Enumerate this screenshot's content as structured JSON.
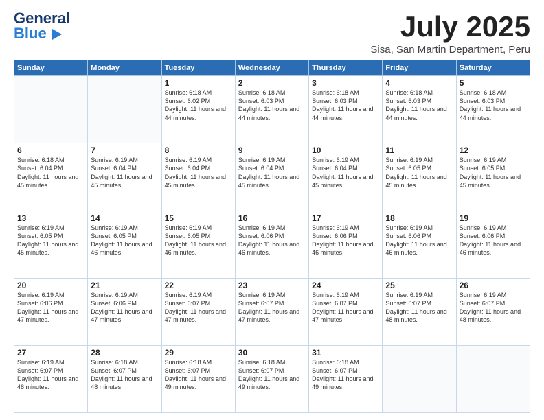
{
  "header": {
    "logo_general": "General",
    "logo_blue": "Blue",
    "month_title": "July 2025",
    "location": "Sisa, San Martin Department, Peru"
  },
  "weekdays": [
    "Sunday",
    "Monday",
    "Tuesday",
    "Wednesday",
    "Thursday",
    "Friday",
    "Saturday"
  ],
  "weeks": [
    [
      {
        "day": "",
        "info": ""
      },
      {
        "day": "",
        "info": ""
      },
      {
        "day": "1",
        "info": "Sunrise: 6:18 AM\nSunset: 6:02 PM\nDaylight: 11 hours and 44 minutes."
      },
      {
        "day": "2",
        "info": "Sunrise: 6:18 AM\nSunset: 6:03 PM\nDaylight: 11 hours and 44 minutes."
      },
      {
        "day": "3",
        "info": "Sunrise: 6:18 AM\nSunset: 6:03 PM\nDaylight: 11 hours and 44 minutes."
      },
      {
        "day": "4",
        "info": "Sunrise: 6:18 AM\nSunset: 6:03 PM\nDaylight: 11 hours and 44 minutes."
      },
      {
        "day": "5",
        "info": "Sunrise: 6:18 AM\nSunset: 6:03 PM\nDaylight: 11 hours and 44 minutes."
      }
    ],
    [
      {
        "day": "6",
        "info": "Sunrise: 6:18 AM\nSunset: 6:04 PM\nDaylight: 11 hours and 45 minutes."
      },
      {
        "day": "7",
        "info": "Sunrise: 6:19 AM\nSunset: 6:04 PM\nDaylight: 11 hours and 45 minutes."
      },
      {
        "day": "8",
        "info": "Sunrise: 6:19 AM\nSunset: 6:04 PM\nDaylight: 11 hours and 45 minutes."
      },
      {
        "day": "9",
        "info": "Sunrise: 6:19 AM\nSunset: 6:04 PM\nDaylight: 11 hours and 45 minutes."
      },
      {
        "day": "10",
        "info": "Sunrise: 6:19 AM\nSunset: 6:04 PM\nDaylight: 11 hours and 45 minutes."
      },
      {
        "day": "11",
        "info": "Sunrise: 6:19 AM\nSunset: 6:05 PM\nDaylight: 11 hours and 45 minutes."
      },
      {
        "day": "12",
        "info": "Sunrise: 6:19 AM\nSunset: 6:05 PM\nDaylight: 11 hours and 45 minutes."
      }
    ],
    [
      {
        "day": "13",
        "info": "Sunrise: 6:19 AM\nSunset: 6:05 PM\nDaylight: 11 hours and 45 minutes."
      },
      {
        "day": "14",
        "info": "Sunrise: 6:19 AM\nSunset: 6:05 PM\nDaylight: 11 hours and 46 minutes."
      },
      {
        "day": "15",
        "info": "Sunrise: 6:19 AM\nSunset: 6:05 PM\nDaylight: 11 hours and 46 minutes."
      },
      {
        "day": "16",
        "info": "Sunrise: 6:19 AM\nSunset: 6:06 PM\nDaylight: 11 hours and 46 minutes."
      },
      {
        "day": "17",
        "info": "Sunrise: 6:19 AM\nSunset: 6:06 PM\nDaylight: 11 hours and 46 minutes."
      },
      {
        "day": "18",
        "info": "Sunrise: 6:19 AM\nSunset: 6:06 PM\nDaylight: 11 hours and 46 minutes."
      },
      {
        "day": "19",
        "info": "Sunrise: 6:19 AM\nSunset: 6:06 PM\nDaylight: 11 hours and 46 minutes."
      }
    ],
    [
      {
        "day": "20",
        "info": "Sunrise: 6:19 AM\nSunset: 6:06 PM\nDaylight: 11 hours and 47 minutes."
      },
      {
        "day": "21",
        "info": "Sunrise: 6:19 AM\nSunset: 6:06 PM\nDaylight: 11 hours and 47 minutes."
      },
      {
        "day": "22",
        "info": "Sunrise: 6:19 AM\nSunset: 6:07 PM\nDaylight: 11 hours and 47 minutes."
      },
      {
        "day": "23",
        "info": "Sunrise: 6:19 AM\nSunset: 6:07 PM\nDaylight: 11 hours and 47 minutes."
      },
      {
        "day": "24",
        "info": "Sunrise: 6:19 AM\nSunset: 6:07 PM\nDaylight: 11 hours and 47 minutes."
      },
      {
        "day": "25",
        "info": "Sunrise: 6:19 AM\nSunset: 6:07 PM\nDaylight: 11 hours and 48 minutes."
      },
      {
        "day": "26",
        "info": "Sunrise: 6:19 AM\nSunset: 6:07 PM\nDaylight: 11 hours and 48 minutes."
      }
    ],
    [
      {
        "day": "27",
        "info": "Sunrise: 6:19 AM\nSunset: 6:07 PM\nDaylight: 11 hours and 48 minutes."
      },
      {
        "day": "28",
        "info": "Sunrise: 6:18 AM\nSunset: 6:07 PM\nDaylight: 11 hours and 48 minutes."
      },
      {
        "day": "29",
        "info": "Sunrise: 6:18 AM\nSunset: 6:07 PM\nDaylight: 11 hours and 49 minutes."
      },
      {
        "day": "30",
        "info": "Sunrise: 6:18 AM\nSunset: 6:07 PM\nDaylight: 11 hours and 49 minutes."
      },
      {
        "day": "31",
        "info": "Sunrise: 6:18 AM\nSunset: 6:07 PM\nDaylight: 11 hours and 49 minutes."
      },
      {
        "day": "",
        "info": ""
      },
      {
        "day": "",
        "info": ""
      }
    ]
  ]
}
